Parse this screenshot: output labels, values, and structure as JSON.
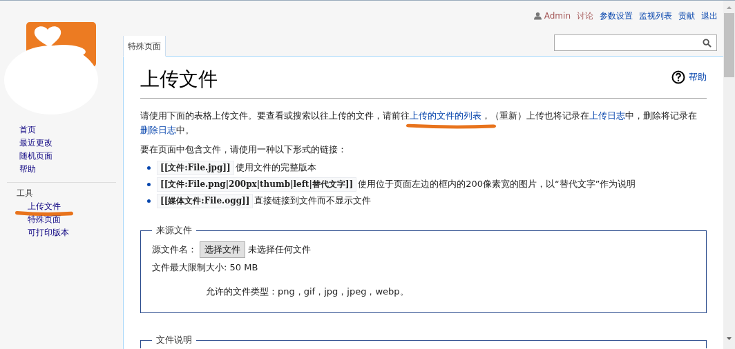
{
  "user_links": [
    {
      "text": "Admin",
      "kind": "user"
    },
    {
      "text": "讨论",
      "kind": "visited"
    },
    {
      "text": "参数设置",
      "kind": "link"
    },
    {
      "text": "监视列表",
      "kind": "link"
    },
    {
      "text": "贡献",
      "kind": "link"
    },
    {
      "text": "退出",
      "kind": "link"
    }
  ],
  "sidebar": {
    "navigation": [
      {
        "label": "首页",
        "highlighted": false
      },
      {
        "label": "最近更改",
        "highlighted": false
      },
      {
        "label": "随机页面",
        "highlighted": false
      },
      {
        "label": "帮助",
        "highlighted": false
      }
    ],
    "tools_heading": "工具",
    "tools": [
      {
        "label": "上传文件",
        "highlighted": true
      },
      {
        "label": "特殊页面",
        "highlighted": false
      },
      {
        "label": "可打印版本",
        "highlighted": false
      }
    ]
  },
  "tabs": [
    {
      "label": "特殊页面",
      "selected": true
    }
  ],
  "page": {
    "title": "上传文件",
    "help_link": "帮助",
    "intro": [
      {
        "kind": "text",
        "text": "请使用下面的表格上传文件。要查看或搜索以往上传的文件，请前往"
      },
      {
        "kind": "link",
        "text": "上传的文件的列表",
        "highlighted": true
      },
      {
        "kind": "text",
        "text": "，（重新）上传也将记录在"
      },
      {
        "kind": "link",
        "text": "上传日志",
        "highlighted": false
      },
      {
        "kind": "text",
        "text": "中，删除将记录在"
      },
      {
        "kind": "link",
        "text": "删除日志",
        "highlighted": false
      },
      {
        "kind": "text",
        "text": "中。"
      }
    ],
    "syntax_intro": "要在页面中包含文件，请使用一种以下形式的链接：",
    "syntax_items": [
      {
        "code": "[[文件:File.jpg]]",
        "description": "使用文件的完整版本"
      },
      {
        "code": "[[文件:File.png|200px|thumb|left|替代文字]]",
        "description": "使用位于页面左边的框内的200像素宽的图片，以“替代文字”作为说明"
      },
      {
        "code": "[[媒体文件:File.ogg]]",
        "description": "直接链接到文件而不显示文件"
      }
    ],
    "source_section": {
      "legend": "来源文件",
      "file_label": "源文件名：",
      "choose_button": "选择文件",
      "no_file": "未选择任何文件",
      "max_size": "文件最大限制大小: 50 MB",
      "allowed_types": "允许的文件类型：png，gif，jpg，jpeg，webp。"
    },
    "description_section": {
      "legend": "文件说明"
    }
  }
}
